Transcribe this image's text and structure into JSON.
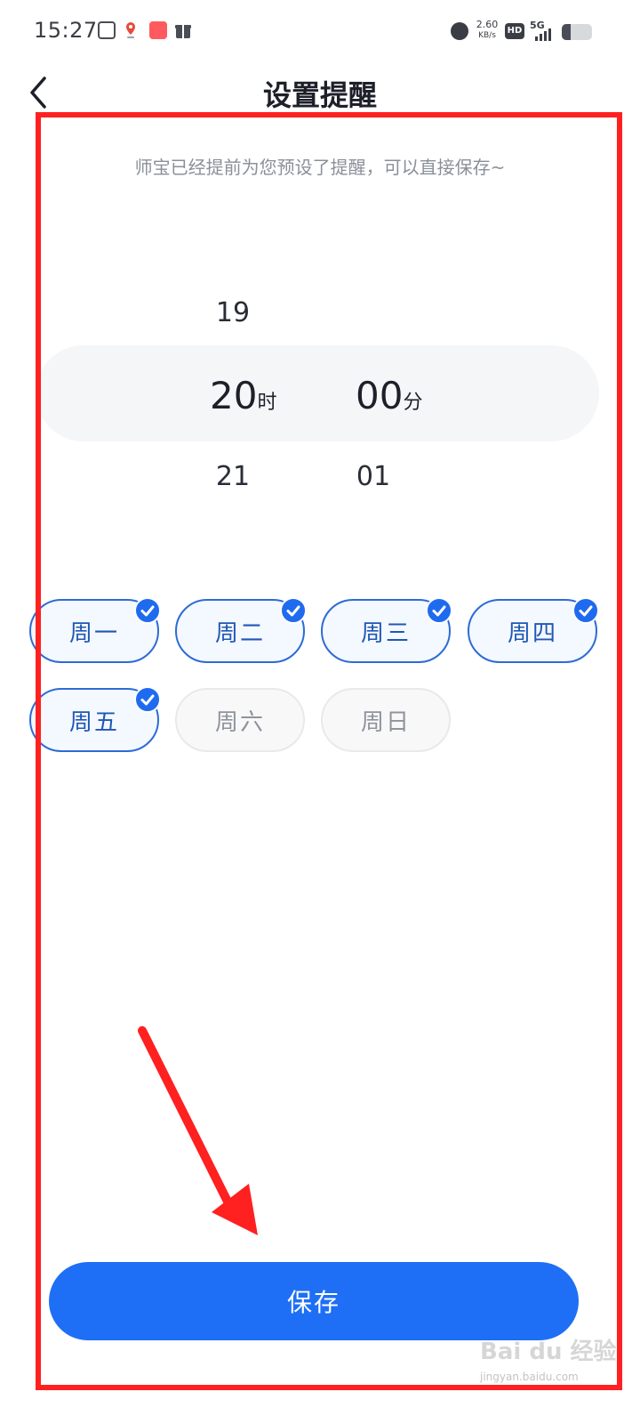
{
  "status_bar": {
    "time": "15:27",
    "net_rate_value": "2.60",
    "net_rate_unit": "KB/s",
    "hd": "HD",
    "signal": "5G"
  },
  "header": {
    "title": "设置提醒"
  },
  "hint": "师宝已经提前为您预设了提醒，可以直接保存~",
  "picker": {
    "hour_prev": "19",
    "hour_selected": "20",
    "hour_unit": "时",
    "hour_next": "21",
    "minute_selected": "00",
    "minute_unit": "分",
    "minute_next": "01"
  },
  "days": [
    {
      "label": "周一",
      "checked": true
    },
    {
      "label": "周二",
      "checked": true
    },
    {
      "label": "周三",
      "checked": true
    },
    {
      "label": "周四",
      "checked": true
    },
    {
      "label": "周五",
      "checked": true
    },
    {
      "label": "周六",
      "checked": false
    },
    {
      "label": "周日",
      "checked": false
    }
  ],
  "save_label": "保存",
  "watermark": {
    "brand": "Bai du 经验",
    "domain": "jingyan.baidu.com"
  },
  "colors": {
    "accent": "#1e6ff5",
    "highlight": "#ff2020"
  }
}
